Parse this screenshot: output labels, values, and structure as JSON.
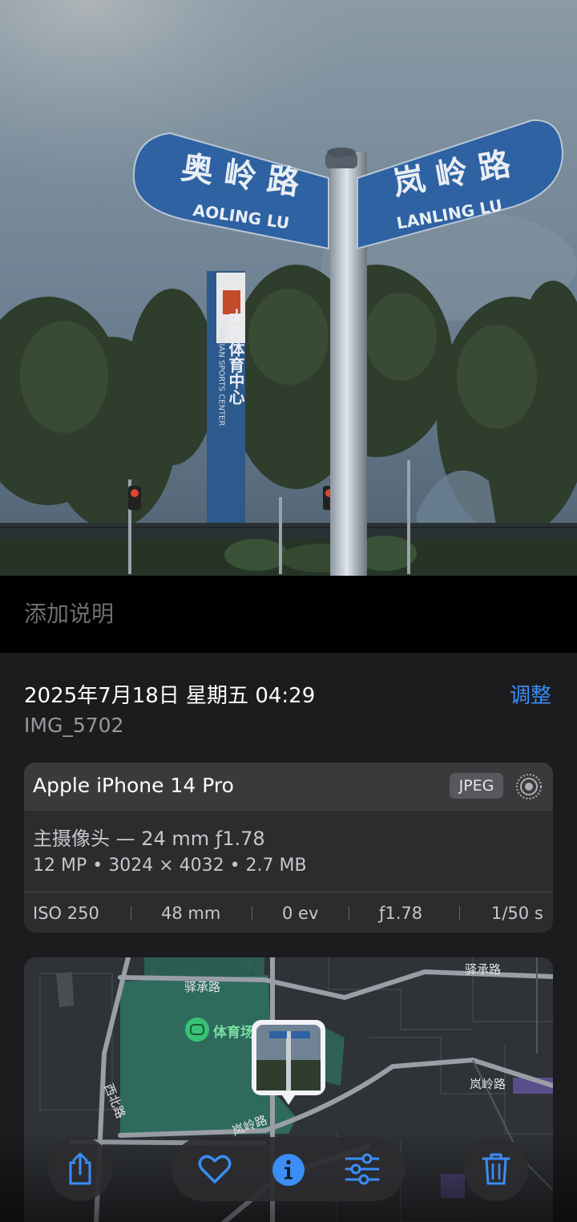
{
  "photo": {
    "sign_left_cn": "奥 岭 路",
    "sign_left_en": "AOLING LU",
    "sign_right_cn": "岚 岭 路",
    "sign_right_en": "LANLING LU",
    "pylon_text": "大连体育中心",
    "pylon_en": "DALIAN SPORTS CENTER"
  },
  "caption": {
    "placeholder": "添加说明"
  },
  "info": {
    "datetime": "2025年7月18日 星期五 04:29",
    "adjust_label": "调整",
    "filename": "IMG_5702"
  },
  "camera": {
    "device": "Apple iPhone 14 Pro",
    "format": "JPEG",
    "lens": "主摄像头 — 24 mm ƒ1.78",
    "specs": "12 MP • 3024 × 4032 • 2.7 MB",
    "exif": {
      "iso": "ISO 250",
      "focal": "48 mm",
      "ev": "0 ev",
      "aperture": "ƒ1.78",
      "shutter": "1/50 s"
    }
  },
  "map": {
    "poi": "体育场",
    "roads": {
      "yicheng_1": "驿承路",
      "yicheng_2": "驿承路",
      "lanling": "岚岭路",
      "aoling": "岚岭路",
      "xibei": "西北路"
    }
  },
  "colors": {
    "accent": "#3a8ef6",
    "sheet_bg": "#1c1c1e",
    "card_bg": "#2c2c2e",
    "map_green": "#2e6b5c"
  },
  "toolbar": {
    "icons": [
      "share-icon",
      "heart-icon",
      "info-icon",
      "sliders-icon",
      "trash-icon"
    ]
  }
}
